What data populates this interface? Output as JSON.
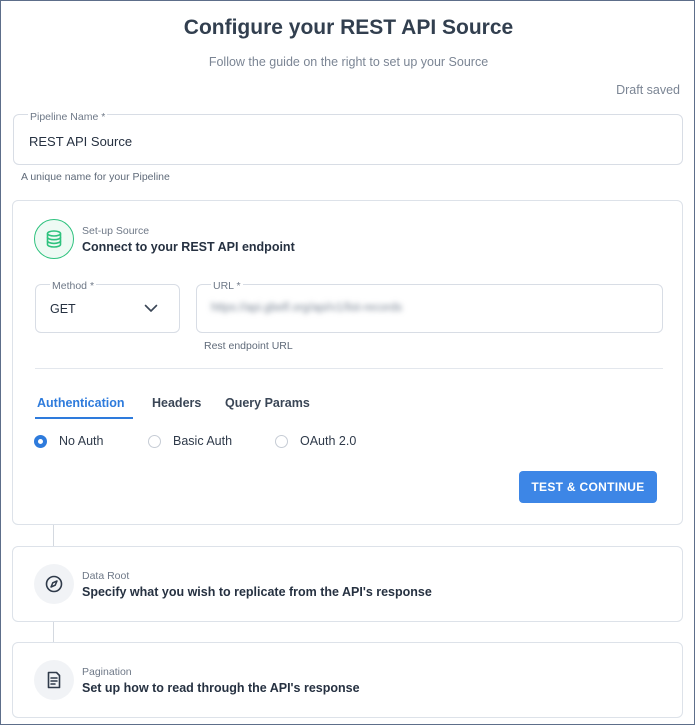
{
  "header": {
    "title": "Configure your REST API Source",
    "subtitle": "Follow the guide on the right to set up your Source",
    "status": "Draft saved"
  },
  "pipeline": {
    "label": "Pipeline Name *",
    "value": "REST API Source",
    "hint": "A unique name for your Pipeline"
  },
  "setup": {
    "kicker": "Set-up Source",
    "heading": "Connect to your REST API endpoint",
    "icon": "database-icon",
    "method": {
      "label": "Method *",
      "value": "GET"
    },
    "url": {
      "label": "URL *",
      "value": "https://api.gbelf.org/api/v1/list-records",
      "hint": "Rest endpoint URL"
    },
    "tabs": [
      {
        "label": "Authentication",
        "active": true
      },
      {
        "label": "Headers",
        "active": false
      },
      {
        "label": "Query Params",
        "active": false
      }
    ],
    "auth_options": [
      {
        "label": "No Auth",
        "checked": true
      },
      {
        "label": "Basic Auth",
        "checked": false
      },
      {
        "label": "OAuth 2.0",
        "checked": false
      }
    ],
    "button_label": "TEST & CONTINUE"
  },
  "steps": [
    {
      "kicker": "Data Root",
      "heading": "Specify what you wish to replicate from the API's response",
      "icon": "compass-icon"
    },
    {
      "kicker": "Pagination",
      "heading": "Set up how to read through the API's response",
      "icon": "document-icon"
    }
  ],
  "colors": {
    "accent": "#2e7bdc",
    "button": "#3d86e6",
    "success": "#2ec27e",
    "text": "#263141"
  }
}
